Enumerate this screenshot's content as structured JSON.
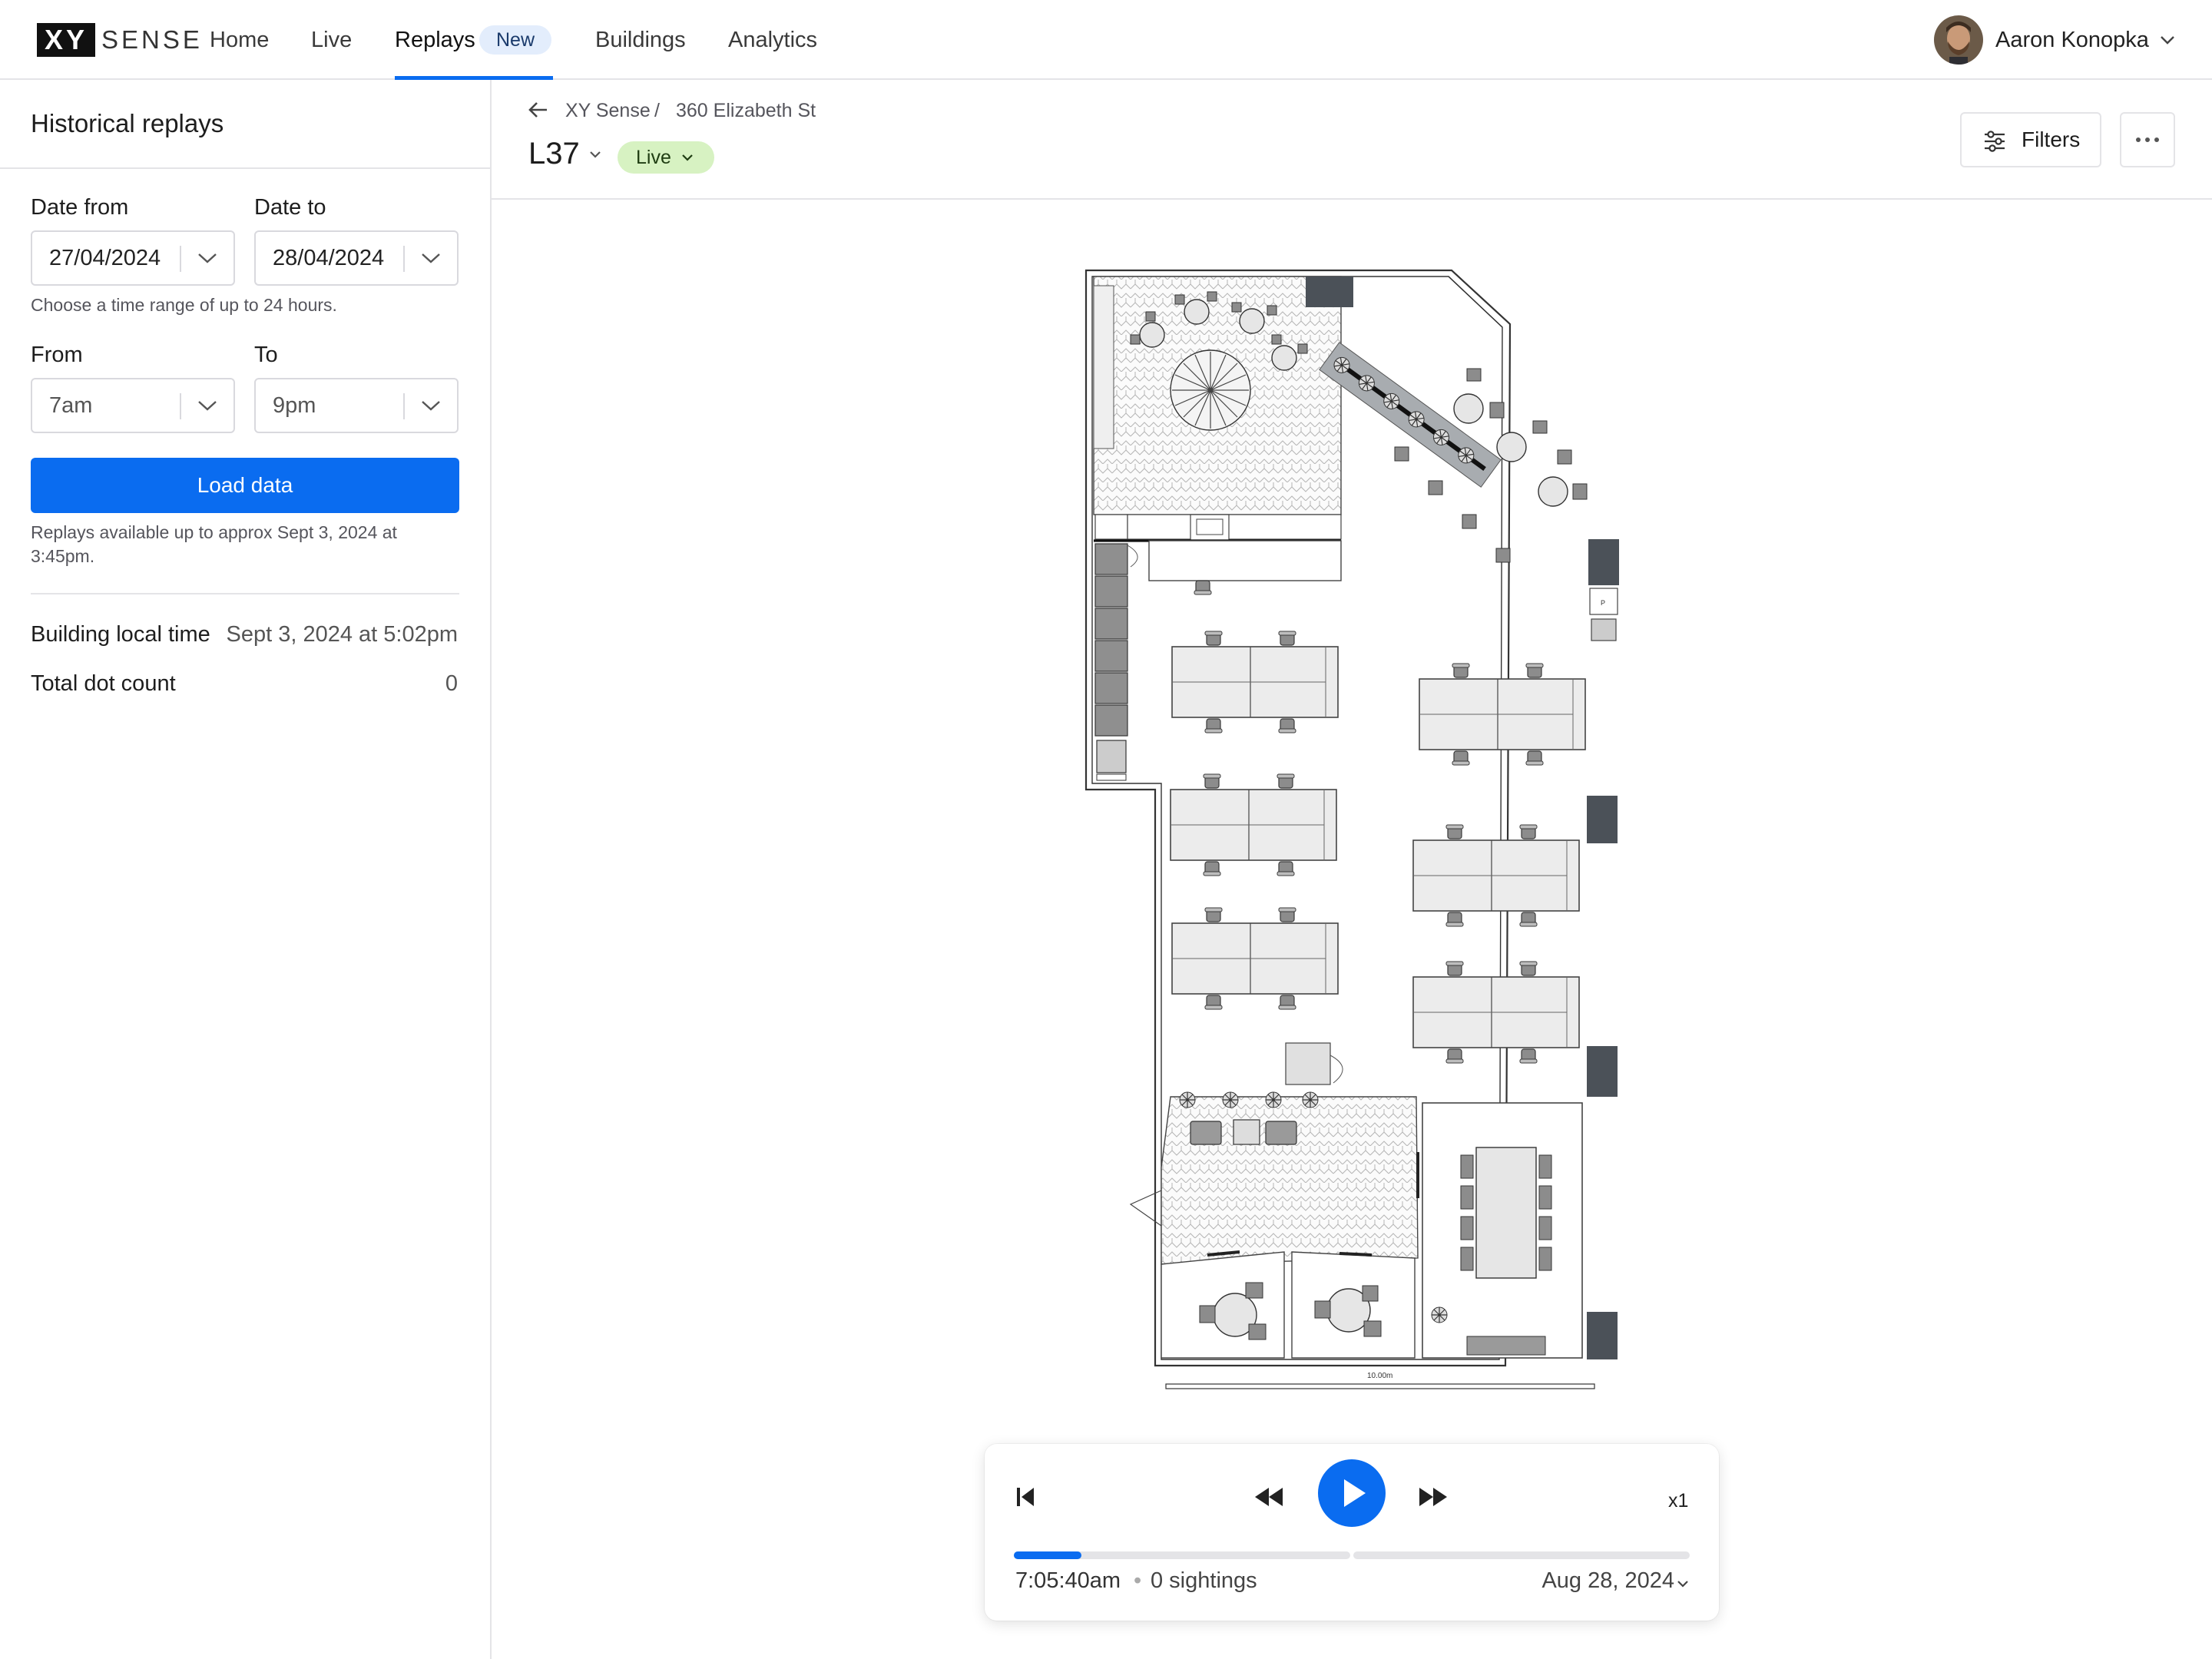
{
  "nav": {
    "logo_mark": "XY",
    "logo_text": "SENSE",
    "items": [
      "Home",
      "Live",
      "Replays",
      "Buildings",
      "Analytics"
    ],
    "new_badge": "New",
    "user_name": "Aaron Konopka"
  },
  "sidebar": {
    "title": "Historical replays",
    "date_from_label": "Date from",
    "date_from_value": "27/04/2024",
    "date_to_label": "Date to",
    "date_to_value": "28/04/2024",
    "range_hint": "Choose a time range of up to 24 hours.",
    "from_label": "From",
    "from_value": "7am",
    "to_label": "To",
    "to_value": "9pm",
    "load_button": "Load data",
    "availability_line1": "Replays available up to approx Sept 3, 2024 at",
    "availability_line2": "3:45pm.",
    "local_time_label": "Building local time",
    "local_time_value": "Sept 3, 2024 at 5:02pm",
    "dot_count_label": "Total dot count",
    "dot_count_value": "0"
  },
  "header": {
    "breadcrumb": [
      "XY Sense",
      "360 Elizabeth St"
    ],
    "breadcrumb_sep": "/",
    "floor": "L37",
    "status": "Live",
    "filters_label": "Filters"
  },
  "plan": {
    "scale_label": "10.00m",
    "marker_label": "P"
  },
  "player": {
    "time": "7:05:40am",
    "separator": "•",
    "sightings": "0 sightings",
    "date": "Aug 28, 2024",
    "speed": "x1",
    "progress": 0.2
  },
  "colors": {
    "accent": "#0a6cf0",
    "live_bg": "#d7f2c2",
    "new_badge_bg": "#e3edfc"
  }
}
